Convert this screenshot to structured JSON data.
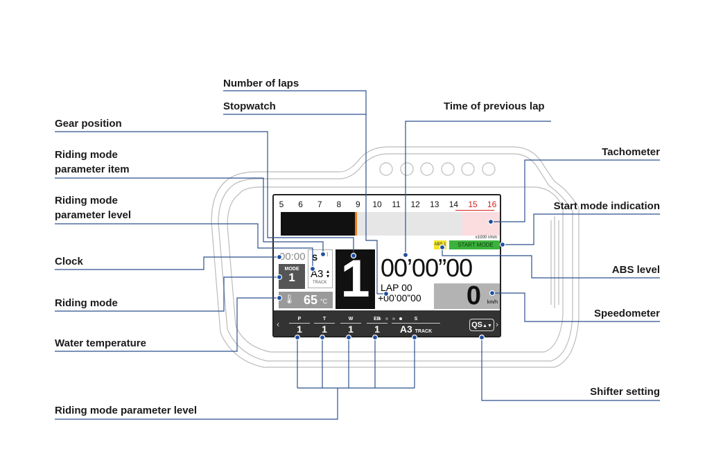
{
  "labels": {
    "number_of_laps": "Number of laps",
    "stopwatch": "Stopwatch",
    "time_of_previous_lap": "Time of previous lap",
    "gear_position": "Gear position",
    "riding_mode_parameter_item": [
      "Riding mode",
      "parameter item"
    ],
    "riding_mode_parameter_level": [
      "Riding mode",
      "parameter level"
    ],
    "clock": "Clock",
    "riding_mode": "Riding mode",
    "water_temperature": "Water temperature",
    "riding_mode_parameter_level_bottom": "Riding mode parameter level",
    "tachometer": "Tachometer",
    "start_mode_indication": "Start mode indication",
    "abs_level": "ABS level",
    "speedometer": "Speedometer",
    "shifter_setting": "Shifter setting"
  },
  "display": {
    "tach_ticks": [
      "5",
      "6",
      "7",
      "8",
      "9",
      "10",
      "11",
      "12",
      "13",
      "14",
      "15",
      "16"
    ],
    "tach_redline_from": "15",
    "tach_value_krpm": 9,
    "tach_unit": "x1000 r/min",
    "abs_badge": "ABS 1",
    "start_mode": "START MODE",
    "clock": "00:00",
    "mode_label": "MODE",
    "mode_value": "1",
    "param_item": "S",
    "param_level": "A3",
    "param_level_sub": "TRACK",
    "gear": "1",
    "water_temp": "65",
    "water_unit": "°C",
    "stopwatch": "00’00”00",
    "lap": "LAP 00",
    "prev_lap": "+00’00”00",
    "speed": "0",
    "speed_unit": "km/h",
    "page_dots": 4,
    "active_page": 4,
    "params": [
      {
        "name": "P",
        "value": "1"
      },
      {
        "name": "T",
        "value": "1"
      },
      {
        "name": "W",
        "value": "1"
      },
      {
        "name": "EB",
        "value": "1"
      },
      {
        "name": "S",
        "value": "A3",
        "sub": "TRACK"
      }
    ],
    "shifter": "QS",
    "prev_arrow": "‹",
    "next_arrow": "›"
  },
  "colors": {
    "leader": "#2b4f8e",
    "tach_fill": "#111111",
    "tach_marker": "#f07d18",
    "redzone": "#fbdde0",
    "abs": "#f2e526",
    "start_mode": "#3bb23b",
    "panel_dark": "#333333"
  }
}
